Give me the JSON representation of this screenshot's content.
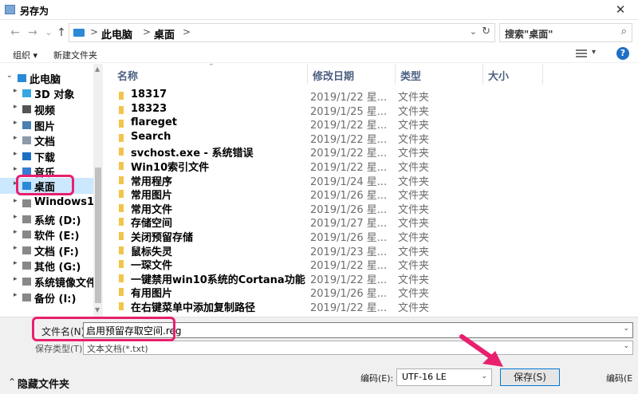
{
  "window": {
    "title": "另存为",
    "close_glyph": "✕"
  },
  "navigation": {
    "back_glyph": "←",
    "forward_glyph": "→",
    "dropdown_glyph": "⌄",
    "up_glyph": "↑",
    "breadcrumb": [
      "此电脑",
      "桌面"
    ],
    "separator": ">",
    "address_dropdown_glyph": "⌄",
    "refresh_glyph": "↻",
    "search_placeholder": "搜索\"桌面\"",
    "search_glyph": "⌕"
  },
  "toolbar": {
    "organize_label": "组织 ▾",
    "new_folder_label": "新建文件夹",
    "view_dropdown_glyph": "▾",
    "help_label": "?"
  },
  "sidebar": {
    "items": [
      {
        "label": "此电脑",
        "icon": "pc-icon",
        "color": "#2a8ad8"
      },
      {
        "label": "3D 对象",
        "icon": "cube-icon",
        "color": "#36a8e0"
      },
      {
        "label": "视频",
        "icon": "video-icon",
        "color": "#555555"
      },
      {
        "label": "图片",
        "icon": "pictures-icon",
        "color": "#4a7fb0"
      },
      {
        "label": "文档",
        "icon": "documents-icon",
        "color": "#8a9aa8"
      },
      {
        "label": "下载",
        "icon": "download-icon",
        "color": "#1c6fc4"
      },
      {
        "label": "音乐",
        "icon": "music-icon",
        "color": "#3a7bd5"
      },
      {
        "label": "桌面",
        "icon": "desktop-icon",
        "color": "#2a8ad8"
      },
      {
        "label": "Windows1(",
        "icon": "windows-drive-icon",
        "color": "#888888"
      },
      {
        "label": "系统 (D:)",
        "icon": "drive-icon",
        "color": "#888888"
      },
      {
        "label": "软件 (E:)",
        "icon": "drive-icon",
        "color": "#888888"
      },
      {
        "label": "文档 (F:)",
        "icon": "drive-icon",
        "color": "#888888"
      },
      {
        "label": "其他 (G:)",
        "icon": "drive-icon",
        "color": "#888888"
      },
      {
        "label": "系统镜像文件",
        "icon": "drive-icon",
        "color": "#888888"
      },
      {
        "label": "备份 (I:)",
        "icon": "drive-icon",
        "color": "#888888"
      }
    ],
    "expand_glyph": "▸",
    "collapse_glyph": "⌄",
    "scroll_up_glyph": "▲",
    "scroll_down_glyph": "▼"
  },
  "file_list": {
    "columns": [
      "名称",
      "修改日期",
      "类型",
      "大小"
    ],
    "sort_glyph": "⌃",
    "rows": [
      {
        "name": "18317",
        "date": "2019/1/22 星...",
        "type": "文件夹"
      },
      {
        "name": "18323",
        "date": "2019/1/25 星...",
        "type": "文件夹"
      },
      {
        "name": "flareget",
        "date": "2019/1/22 星...",
        "type": "文件夹"
      },
      {
        "name": "Search",
        "date": "2019/1/22 星...",
        "type": "文件夹"
      },
      {
        "name": "svchost.exe - 系统错误",
        "date": "2019/1/22 星...",
        "type": "文件夹"
      },
      {
        "name": "Win10索引文件",
        "date": "2019/1/22 星...",
        "type": "文件夹"
      },
      {
        "name": "常用程序",
        "date": "2019/1/24 星...",
        "type": "文件夹"
      },
      {
        "name": "常用图片",
        "date": "2019/1/26 星...",
        "type": "文件夹"
      },
      {
        "name": "常用文件",
        "date": "2019/1/26 星...",
        "type": "文件夹"
      },
      {
        "name": "存储空间",
        "date": "2019/1/27 星...",
        "type": "文件夹"
      },
      {
        "name": "关闭预留存储",
        "date": "2019/1/26 星...",
        "type": "文件夹"
      },
      {
        "name": "鼠标失灵",
        "date": "2019/1/23 星...",
        "type": "文件夹"
      },
      {
        "name": "一琛文件",
        "date": "2019/1/22 星...",
        "type": "文件夹"
      },
      {
        "name": "一键禁用win10系统的Cortana功能",
        "date": "2019/1/22 星...",
        "type": "文件夹"
      },
      {
        "name": "有用图片",
        "date": "2019/1/26 星...",
        "type": "文件夹"
      },
      {
        "name": "在右键菜单中添加复制路径",
        "date": "2019/1/22 星...",
        "type": "文件夹"
      }
    ]
  },
  "footer": {
    "filename_label": "文件名(N):",
    "filename_value": "启用预留存取空间.reg",
    "filetype_label": "保存类型(T):",
    "filetype_value": "文本文档(*.txt)",
    "hide_folders_label": "隐藏文件夹",
    "hide_folders_glyph": "⌃",
    "encoding_label": "编码(E):",
    "encoding_value": "UTF-16 LE",
    "save_label": "保存(S)",
    "encoding_label_right": "编码(E",
    "dropdown_glyph": "⌄"
  },
  "annotations": {
    "highlight_color": "#e8206e"
  }
}
